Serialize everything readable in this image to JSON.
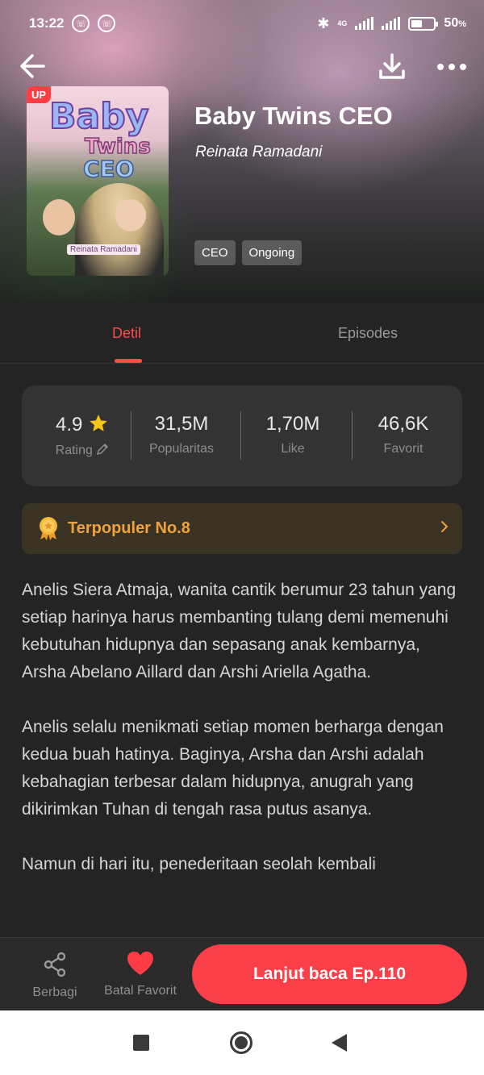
{
  "status_bar": {
    "time": "13:22",
    "network": "4G",
    "battery_percent": "50",
    "battery_suffix": "%",
    "battery_level": 0.5
  },
  "top_bar": {
    "back_icon": "arrow-left-icon",
    "download_icon": "download-icon",
    "more_icon": "more-horizontal-icon"
  },
  "book": {
    "badge": "UP",
    "cover_title_1": "Baby",
    "cover_title_2": "Twins",
    "cover_title_3": "CEO",
    "cover_author": "Reinata Ramadani",
    "title": "Baby Twins CEO",
    "author": "Reinata Ramadani",
    "tags": [
      "CEO",
      "Ongoing"
    ]
  },
  "tabs": [
    {
      "label": "Detil",
      "active": true
    },
    {
      "label": "Episodes",
      "active": false
    }
  ],
  "stats": [
    {
      "value": "4.9",
      "label": "Rating",
      "icon": "star-icon",
      "label_icon": "pencil-icon"
    },
    {
      "value": "31,5M",
      "label": "Popularitas"
    },
    {
      "value": "1,70M",
      "label": "Like"
    },
    {
      "value": "46,6K",
      "label": "Favorit"
    }
  ],
  "ranking": {
    "label": "Terpopuler No.8",
    "icon": "medal-icon",
    "arrow_icon": "chevron-right-icon"
  },
  "description": [
    "Anelis Siera Atmaja, wanita cantik berumur 23 tahun yang setiap harinya harus membanting tulang demi memenuhi kebutuhan hidupnya dan sepasang anak kembarnya, Arsha Abelano Aillard dan Arshi Ariella Agatha.",
    "Anelis selalu menikmati setiap momen berharga dengan kedua buah hatinya. Baginya, Arsha dan Arshi adalah kebahagian terbesar dalam hidupnya, anugrah yang dikirimkan Tuhan di tengah rasa putus asanya.",
    "Namun di hari itu, penederitaan seolah kembali"
  ],
  "bottom_bar": {
    "share_label": "Berbagi",
    "favorite_label": "Batal Favorit",
    "continue_label": "Lanjut baca Ep.110"
  },
  "colors": {
    "accent": "#fb3f48",
    "background": "#242424",
    "card": "#333333",
    "rank_bg": "#3a3222",
    "rank_text": "#f0a140"
  }
}
